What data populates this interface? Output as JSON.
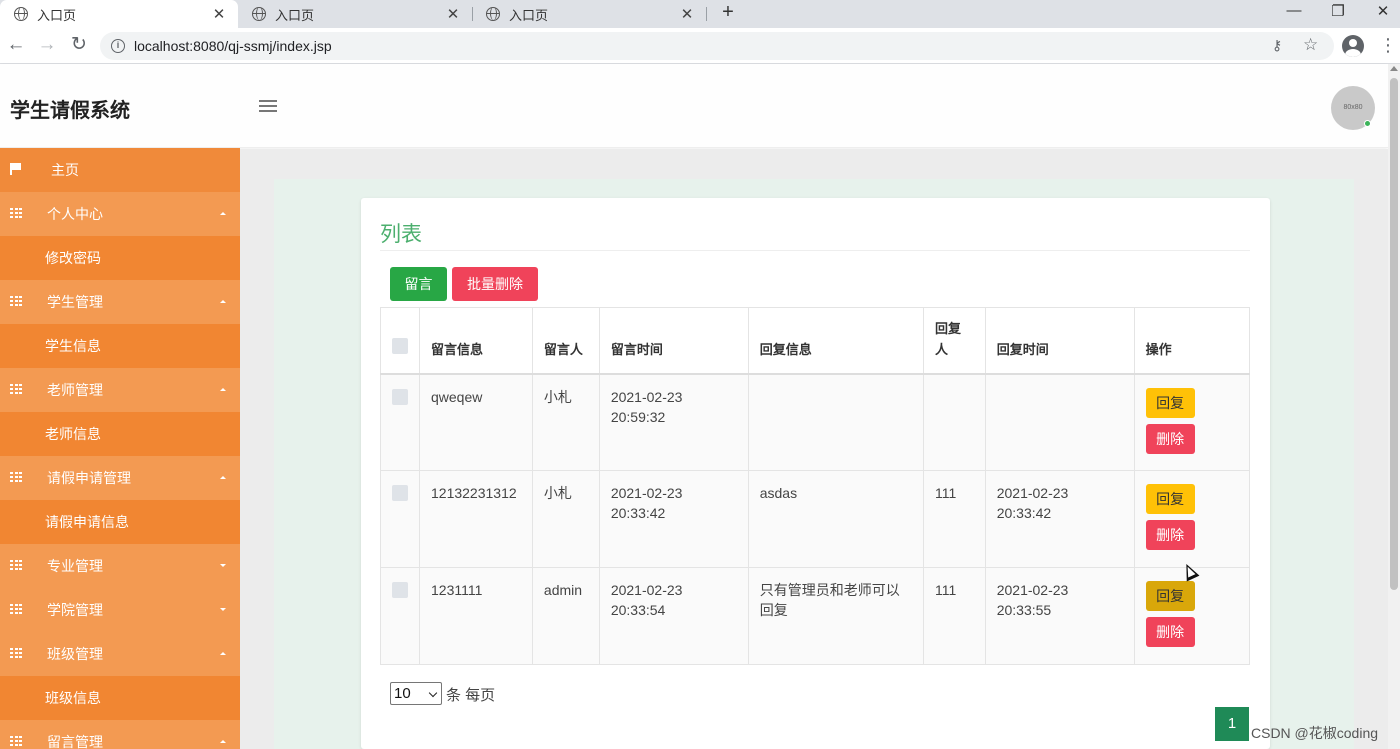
{
  "browser": {
    "tabs": [
      {
        "title": "入口页"
      },
      {
        "title": "入口页"
      },
      {
        "title": "入口页"
      }
    ],
    "close_glyph": "✕",
    "new_tab_glyph": "+",
    "window_buttons": {
      "minimize": "—",
      "restore": "❐",
      "close": "✕"
    },
    "nav": {
      "back": "←",
      "forward": "→",
      "reload": "↻"
    },
    "url": "localhost:8080/qj-ssmj/index.jsp",
    "icons": {
      "info": "i",
      "key": "⚷",
      "star": "☆",
      "menu": "⋮"
    }
  },
  "header": {
    "app_title": "学生请假系统",
    "avatar_text": "80x80"
  },
  "sidebar": {
    "items": [
      {
        "label": "主页",
        "kind": "home"
      },
      {
        "label": "个人中心",
        "kind": "group",
        "expanded": true
      },
      {
        "label": "修改密码",
        "kind": "sub"
      },
      {
        "label": "学生管理",
        "kind": "group",
        "expanded": true
      },
      {
        "label": "学生信息",
        "kind": "sub"
      },
      {
        "label": "老师管理",
        "kind": "group",
        "expanded": true
      },
      {
        "label": "老师信息",
        "kind": "sub"
      },
      {
        "label": "请假申请管理",
        "kind": "group",
        "expanded": true
      },
      {
        "label": "请假申请信息",
        "kind": "sub"
      },
      {
        "label": "专业管理",
        "kind": "group",
        "expanded": false
      },
      {
        "label": "学院管理",
        "kind": "group",
        "expanded": false
      },
      {
        "label": "班级管理",
        "kind": "group",
        "expanded": true
      },
      {
        "label": "班级信息",
        "kind": "sub"
      },
      {
        "label": "留言管理",
        "kind": "group",
        "expanded": true
      }
    ]
  },
  "panel": {
    "title": "列表",
    "buttons": {
      "message": "留言",
      "bulk_delete": "批量删除"
    },
    "table": {
      "headers": [
        "留言信息",
        "留言人",
        "留言时间",
        "回复信息",
        "回复人",
        "回复时间",
        "操作"
      ],
      "rows": [
        {
          "message": "qweqew",
          "author": "小札",
          "time": "2021-02-23 20:59:32",
          "reply": "",
          "replier": "",
          "reply_time": ""
        },
        {
          "message": "12132231312",
          "author": "小札",
          "time": "2021-02-23 20:33:42",
          "reply": "asdas",
          "replier": "111",
          "reply_time": "2021-02-23 20:33:42"
        },
        {
          "message": "1231111",
          "author": "admin",
          "time": "2021-02-23 20:33:54",
          "reply": "只有管理员和老师可以回复",
          "replier": "111",
          "reply_time": "2021-02-23 20:33:55"
        }
      ],
      "actions": {
        "reply": "回复",
        "delete": "删除"
      }
    },
    "pagination": {
      "page_size": "10",
      "per_page_label": "条 每页",
      "current_page": "1"
    }
  },
  "watermark": "CSDN @花椒coding",
  "colors": {
    "sidebar": "#f18632",
    "title_green": "#4caf6e",
    "btn_green": "#28a745",
    "btn_red": "#f0435a",
    "btn_yellow": "#ffc107",
    "page_active": "#1f8a57"
  }
}
